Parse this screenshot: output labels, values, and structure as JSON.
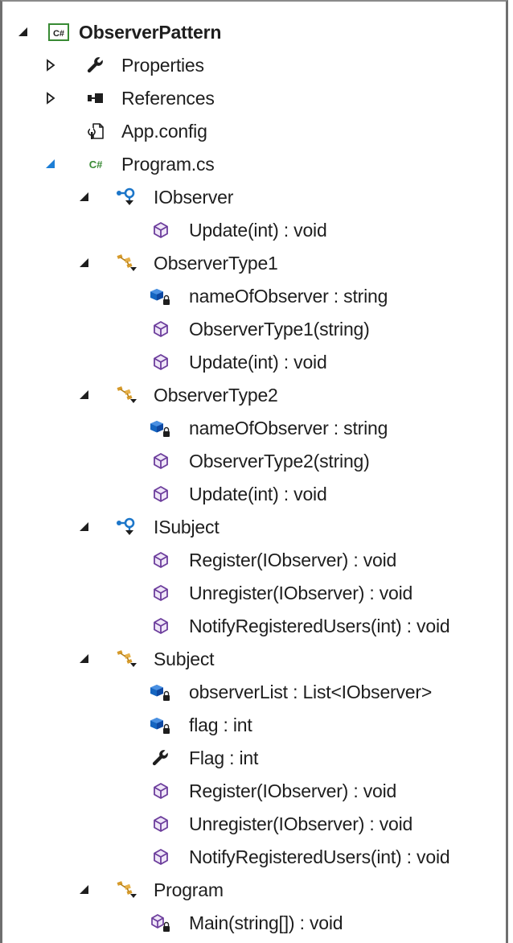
{
  "solution_explorer": {
    "project": {
      "label": "ObserverPattern",
      "icon": "csharp-project-icon"
    },
    "items": {
      "properties": {
        "label": "Properties",
        "icon": "wrench-icon"
      },
      "references": {
        "label": "References",
        "icon": "references-icon"
      },
      "app_config": {
        "label": "App.config",
        "icon": "config-file-icon"
      },
      "program_cs": {
        "label": "Program.cs",
        "icon": "csharp-file-icon"
      }
    },
    "types": {
      "iobserver": {
        "label": "IObserver",
        "icon": "interface-icon",
        "members": [
          "Update(int) : void"
        ]
      },
      "observertype1": {
        "label": "ObserverType1",
        "icon": "class-icon",
        "members": [
          "nameOfObserver : string",
          "ObserverType1(string)",
          "Update(int) : void"
        ]
      },
      "observertype2": {
        "label": "ObserverType2",
        "icon": "class-icon",
        "members": [
          "nameOfObserver : string",
          "ObserverType2(string)",
          "Update(int) : void"
        ]
      },
      "isubject": {
        "label": "ISubject",
        "icon": "interface-icon",
        "members": [
          "Register(IObserver) : void",
          "Unregister(IObserver) : void",
          "NotifyRegisteredUsers(int) : void"
        ]
      },
      "subject": {
        "label": "Subject",
        "icon": "class-icon",
        "members": [
          "observerList : List<IObserver>",
          "flag : int",
          "Flag : int",
          "Register(IObserver) : void",
          "Unregister(IObserver) : void",
          "NotifyRegisteredUsers(int) : void"
        ]
      },
      "program": {
        "label": "Program",
        "icon": "class-icon",
        "members": [
          "Main(string[]) : void"
        ]
      }
    },
    "colors": {
      "method_purple": "#6c3d9c",
      "field_blue": "#1565c0",
      "class_orange": "#d69a2a",
      "interface_blue": "#1c76c9",
      "csharp_green": "#388a34",
      "expander_dark": "#1e1e1e",
      "expander_blue": "#1c7ed6"
    }
  }
}
